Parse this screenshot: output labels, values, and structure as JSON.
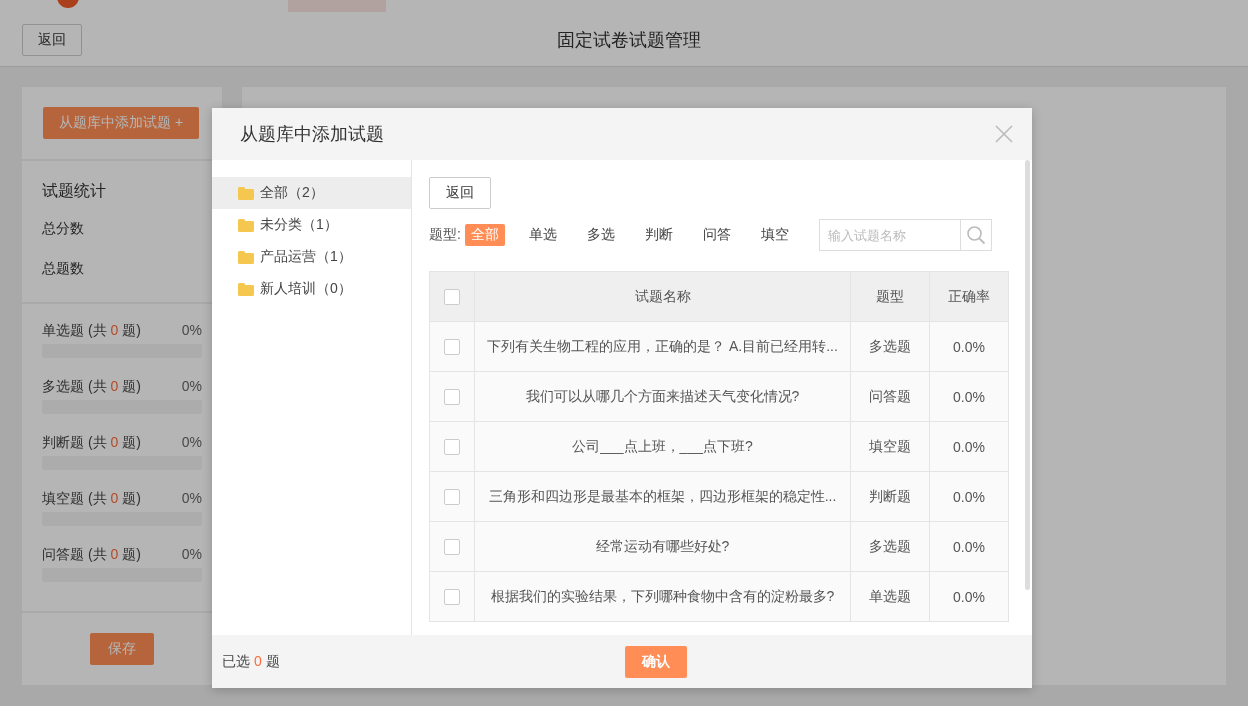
{
  "page": {
    "back_button": "返回",
    "title": "固定试卷试题管理"
  },
  "sidebar": {
    "add_button": "从题库中添加试题 +",
    "stats_title": "试题统计",
    "summary": [
      "总分数",
      "总题数"
    ],
    "types": [
      {
        "before": "单选题 (共",
        "count": "0",
        "after": "题)",
        "percent": "0%",
        "level": 0
      },
      {
        "before": "多选题 (共",
        "count": "0",
        "after": "题)",
        "percent": "0%",
        "level": 0
      },
      {
        "before": "判断题 (共",
        "count": "0",
        "after": "题)",
        "percent": "0%",
        "level": 0
      },
      {
        "before": "填空题 (共",
        "count": "0",
        "after": "题)",
        "percent": "0%",
        "level": 0
      },
      {
        "before": "问答题 (共",
        "count": "0",
        "after": "题)",
        "percent": "0%",
        "level": 0
      }
    ],
    "save_button": "保存"
  },
  "dialog": {
    "title": "从题库中添加试题",
    "categories": [
      {
        "label": "全部（2）",
        "selected": true
      },
      {
        "label": "未分类（1）",
        "selected": false
      },
      {
        "label": "产品运营（1）",
        "selected": false
      },
      {
        "label": "新人培训（0）",
        "selected": false
      }
    ],
    "back_button": "返回",
    "filter_label": "题型:",
    "filters": [
      {
        "label": "全部",
        "selected": true
      },
      {
        "label": "单选",
        "selected": false
      },
      {
        "label": "多选",
        "selected": false
      },
      {
        "label": "判断",
        "selected": false
      },
      {
        "label": "问答",
        "selected": false
      },
      {
        "label": "填空",
        "selected": false
      }
    ],
    "search": {
      "placeholder": "输入试题名称"
    },
    "table": {
      "select_all_checked": false,
      "columns": [
        "试题名称",
        "题型",
        "正确率"
      ],
      "rows": [
        {
          "checked": false,
          "name": "下列有关生物工程的应用，正确的是？ A.目前已经用转...",
          "type": "多选题",
          "rate": "0.0%"
        },
        {
          "checked": false,
          "name": "我们可以从哪几个方面来描述天气变化情况?",
          "type": "问答题",
          "rate": "0.0%"
        },
        {
          "checked": false,
          "name": "公司___点上班，___点下班?",
          "type": "填空题",
          "rate": "0.0%"
        },
        {
          "checked": false,
          "name": "三角形和四边形是最基本的框架，四边形框架的稳定性...",
          "type": "判断题",
          "rate": "0.0%"
        },
        {
          "checked": false,
          "name": "经常运动有哪些好处?",
          "type": "多选题",
          "rate": "0.0%"
        },
        {
          "checked": false,
          "name": "根据我们的实验结果，下列哪种食物中含有的淀粉最多?",
          "type": "单选题",
          "rate": "0.0%"
        }
      ]
    },
    "selected_count": {
      "before": "已选",
      "count": "0",
      "after": "题"
    },
    "confirm_button": "确认"
  }
}
